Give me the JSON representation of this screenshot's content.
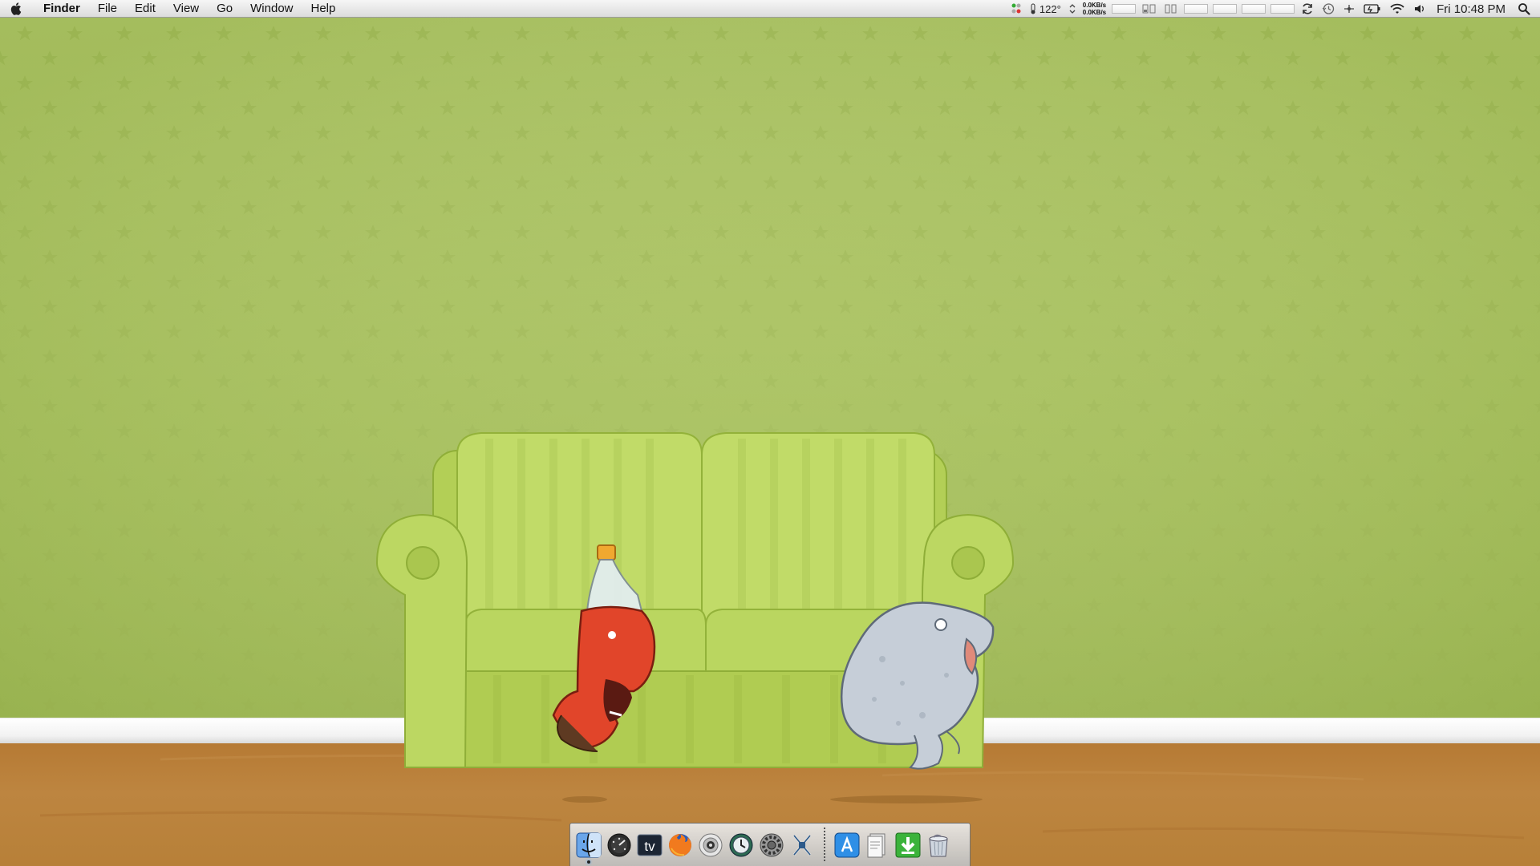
{
  "menubar": {
    "app_name": "Finder",
    "items": [
      "File",
      "Edit",
      "View",
      "Go",
      "Window",
      "Help"
    ],
    "status": {
      "temperature": "122°",
      "net_up": "0.0KB/s",
      "net_down": "0.0KB/s",
      "clock": "Fri 10:48 PM"
    },
    "icons": [
      "apple-logo-icon",
      "istat-icon",
      "temperature-icon",
      "network-icon",
      "cpu-meter-icon",
      "memory-meter-icon",
      "disk-meter-icon",
      "sync-icon",
      "time-machine-icon",
      "bluetooth-icon",
      "battery-icon",
      "wifi-icon",
      "volume-icon",
      "spotlight-icon"
    ]
  },
  "desktop": {
    "wallpaper": "green-star-wallpaper-couch-cartoon",
    "colors": {
      "wall": "#a9c25f",
      "couch": "#b9d45c",
      "floor": "#b8803a",
      "soda": "#e1452a",
      "blob": "#c6ced8"
    }
  },
  "dock": {
    "apps": [
      {
        "name": "finder-icon",
        "running": true
      },
      {
        "name": "dashboard-icon",
        "running": false
      },
      {
        "name": "tv-icon",
        "running": false
      },
      {
        "name": "firefox-icon",
        "running": false
      },
      {
        "name": "dvd-player-icon",
        "running": false
      },
      {
        "name": "time-machine-icon",
        "running": false
      },
      {
        "name": "system-preferences-icon",
        "running": false
      },
      {
        "name": "utility-icon",
        "running": false
      }
    ],
    "stacks": [
      {
        "name": "app-store-icon"
      },
      {
        "name": "documents-icon"
      },
      {
        "name": "downloads-icon"
      },
      {
        "name": "trash-icon"
      }
    ],
    "tv_label": "tv"
  }
}
